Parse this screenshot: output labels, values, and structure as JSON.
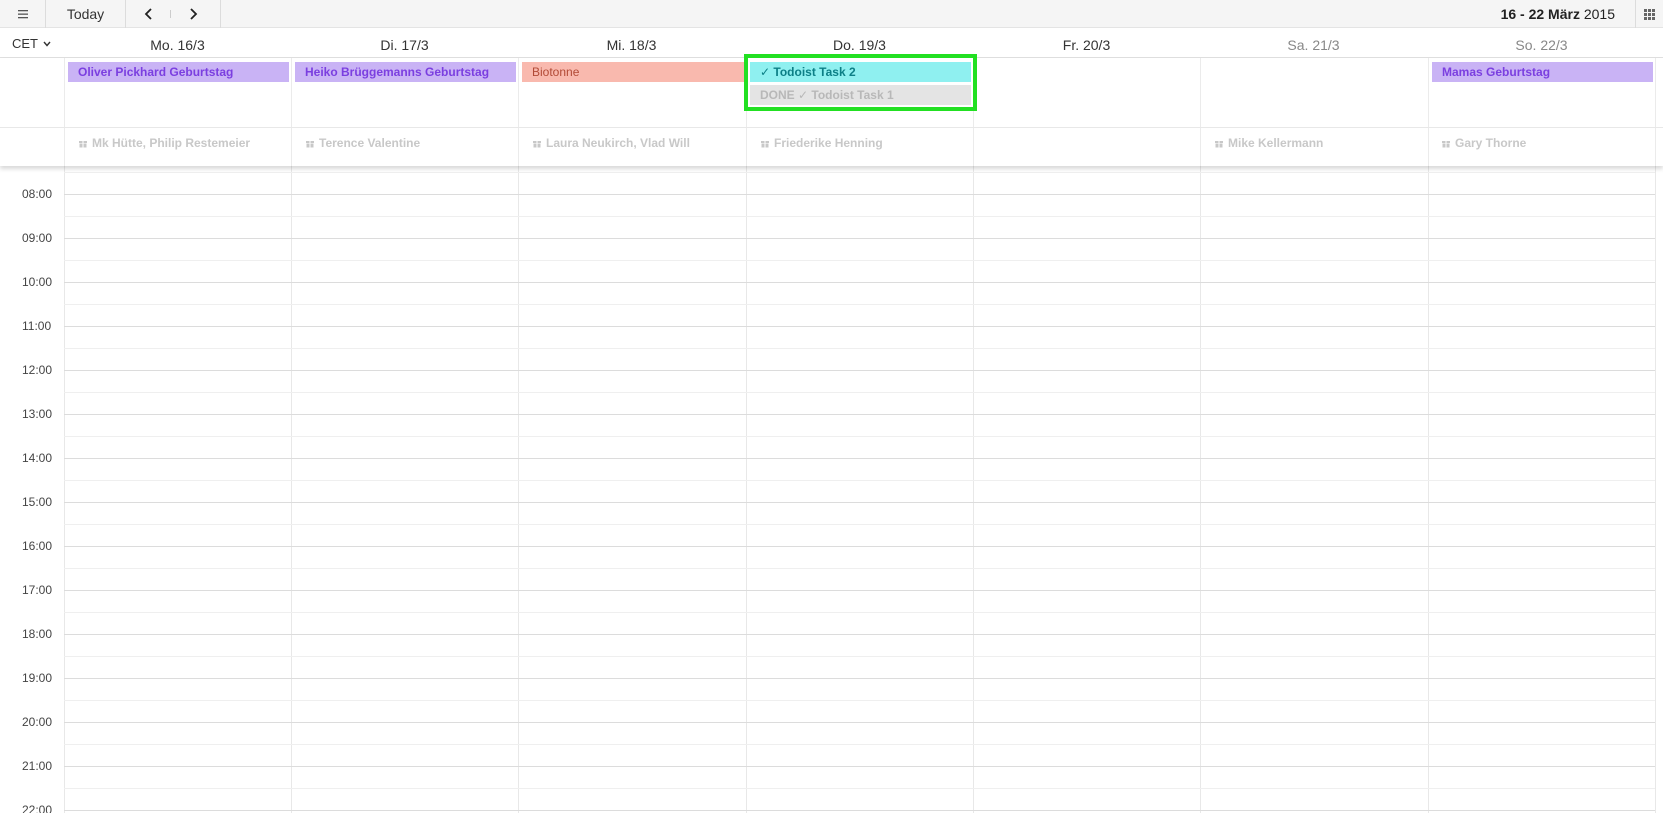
{
  "toolbar": {
    "menu_icon": "menu-icon",
    "today_label": "Today",
    "prev_icon": "chevron-left-icon",
    "next_icon": "chevron-right-icon",
    "range_days": "16 - 22",
    "range_month": "März",
    "range_year": "2015",
    "apps_icon": "grid-icon"
  },
  "timezone": "CET",
  "days": [
    {
      "label": "Mo. 16/3"
    },
    {
      "label": "Di. 17/3"
    },
    {
      "label": "Mi. 18/3"
    },
    {
      "label": "Do. 19/3"
    },
    {
      "label": "Fr. 20/3"
    },
    {
      "label": "Sa. 21/3"
    },
    {
      "label": "So. 22/3"
    }
  ],
  "allday_events": [
    {
      "title": "Oliver Pickhard Geburtstag",
      "day": 0,
      "row": 0,
      "style": "purple",
      "color": "#c9b3f5"
    },
    {
      "title": "Heiko Brüggemanns Geburtstag",
      "day": 1,
      "row": 0,
      "style": "purple",
      "color": "#c9b3f5"
    },
    {
      "title": "Biotonne",
      "day": 2,
      "row": 0,
      "style": "salmon",
      "color": "#f9b9ae"
    },
    {
      "title": "✓ Todoist Task 2",
      "day": 3,
      "row": 0,
      "style": "cyan",
      "color": "#8ff0f0"
    },
    {
      "title": "DONE ✓ Todoist Task 1",
      "day": 3,
      "row": 1,
      "style": "done",
      "color": "#e4e4e4"
    },
    {
      "title": "Mamas Geburtstag",
      "day": 6,
      "row": 0,
      "style": "purple",
      "color": "#c9b3f5"
    }
  ],
  "birthdays": [
    {
      "day": 0,
      "text": "Mk Hütte, Philip Restemeier"
    },
    {
      "day": 1,
      "text": "Terence Valentine"
    },
    {
      "day": 2,
      "text": "Laura Neukirch, Vlad Will"
    },
    {
      "day": 3,
      "text": "Friederike Henning"
    },
    {
      "day": 5,
      "text": "Mike Kellermann"
    },
    {
      "day": 6,
      "text": "Gary Thorne"
    }
  ],
  "hours": [
    "08:00",
    "09:00",
    "10:00",
    "11:00",
    "12:00",
    "13:00",
    "14:00",
    "15:00",
    "16:00",
    "17:00",
    "18:00",
    "19:00",
    "20:00",
    "21:00",
    "22:00"
  ],
  "colors": {
    "highlight": "#22e022",
    "purple_event": "#c9b3f5",
    "salmon_event": "#f9b9ae",
    "cyan_event": "#8ff0f0",
    "done_event": "#e4e4e4"
  }
}
